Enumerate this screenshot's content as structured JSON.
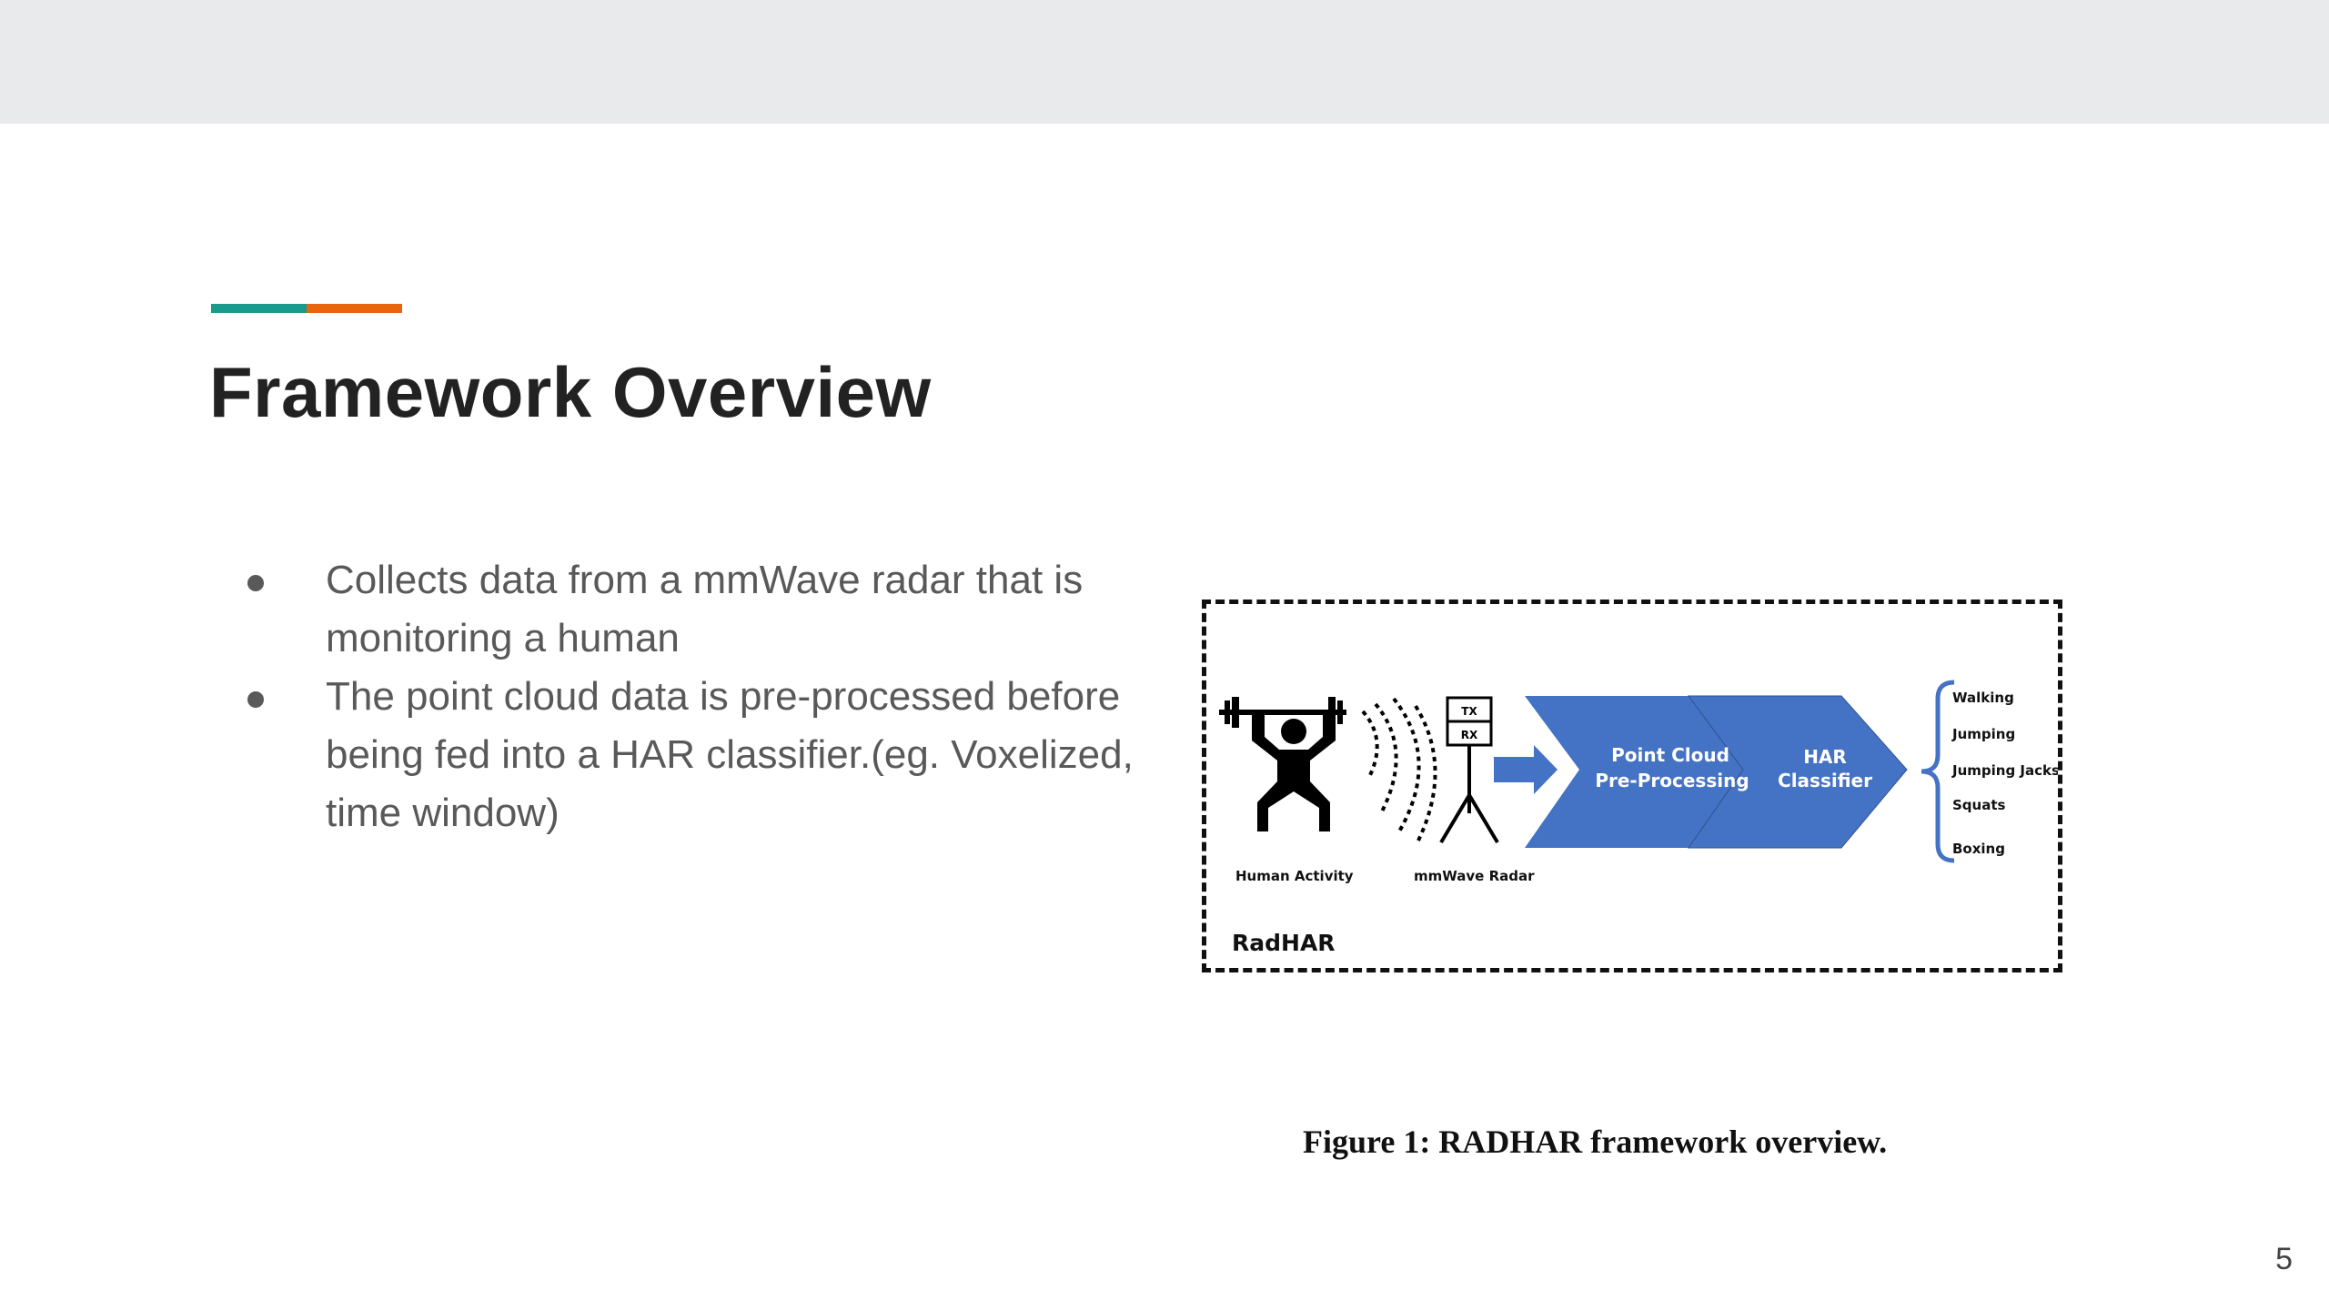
{
  "colors": {
    "accent_teal": "#1a9a8a",
    "accent_orange": "#e8640e",
    "arrow_blue": "#4472c4"
  },
  "slide": {
    "title": "Framework Overview",
    "bullets": [
      "Collects data from a mmWave radar that is monitoring a human",
      "The point cloud data is pre-processed before being fed into a HAR classifier.(eg. Voxelized, time window)"
    ],
    "page_number": "5"
  },
  "figure": {
    "radar_tx": "TX",
    "radar_rx": "RX",
    "human_label": "Human Activity",
    "radar_label": "mmWave Radar",
    "stage1_line1": "Point Cloud",
    "stage1_line2": "Pre-Processing",
    "stage2_line1": "HAR",
    "stage2_line2": "Classifier",
    "activities": [
      "Walking",
      "Jumping",
      "Jumping Jacks",
      "Squats",
      "Boxing"
    ],
    "framework_name": "RadHAR",
    "caption": "Figure 1: RADHAR framework overview."
  }
}
